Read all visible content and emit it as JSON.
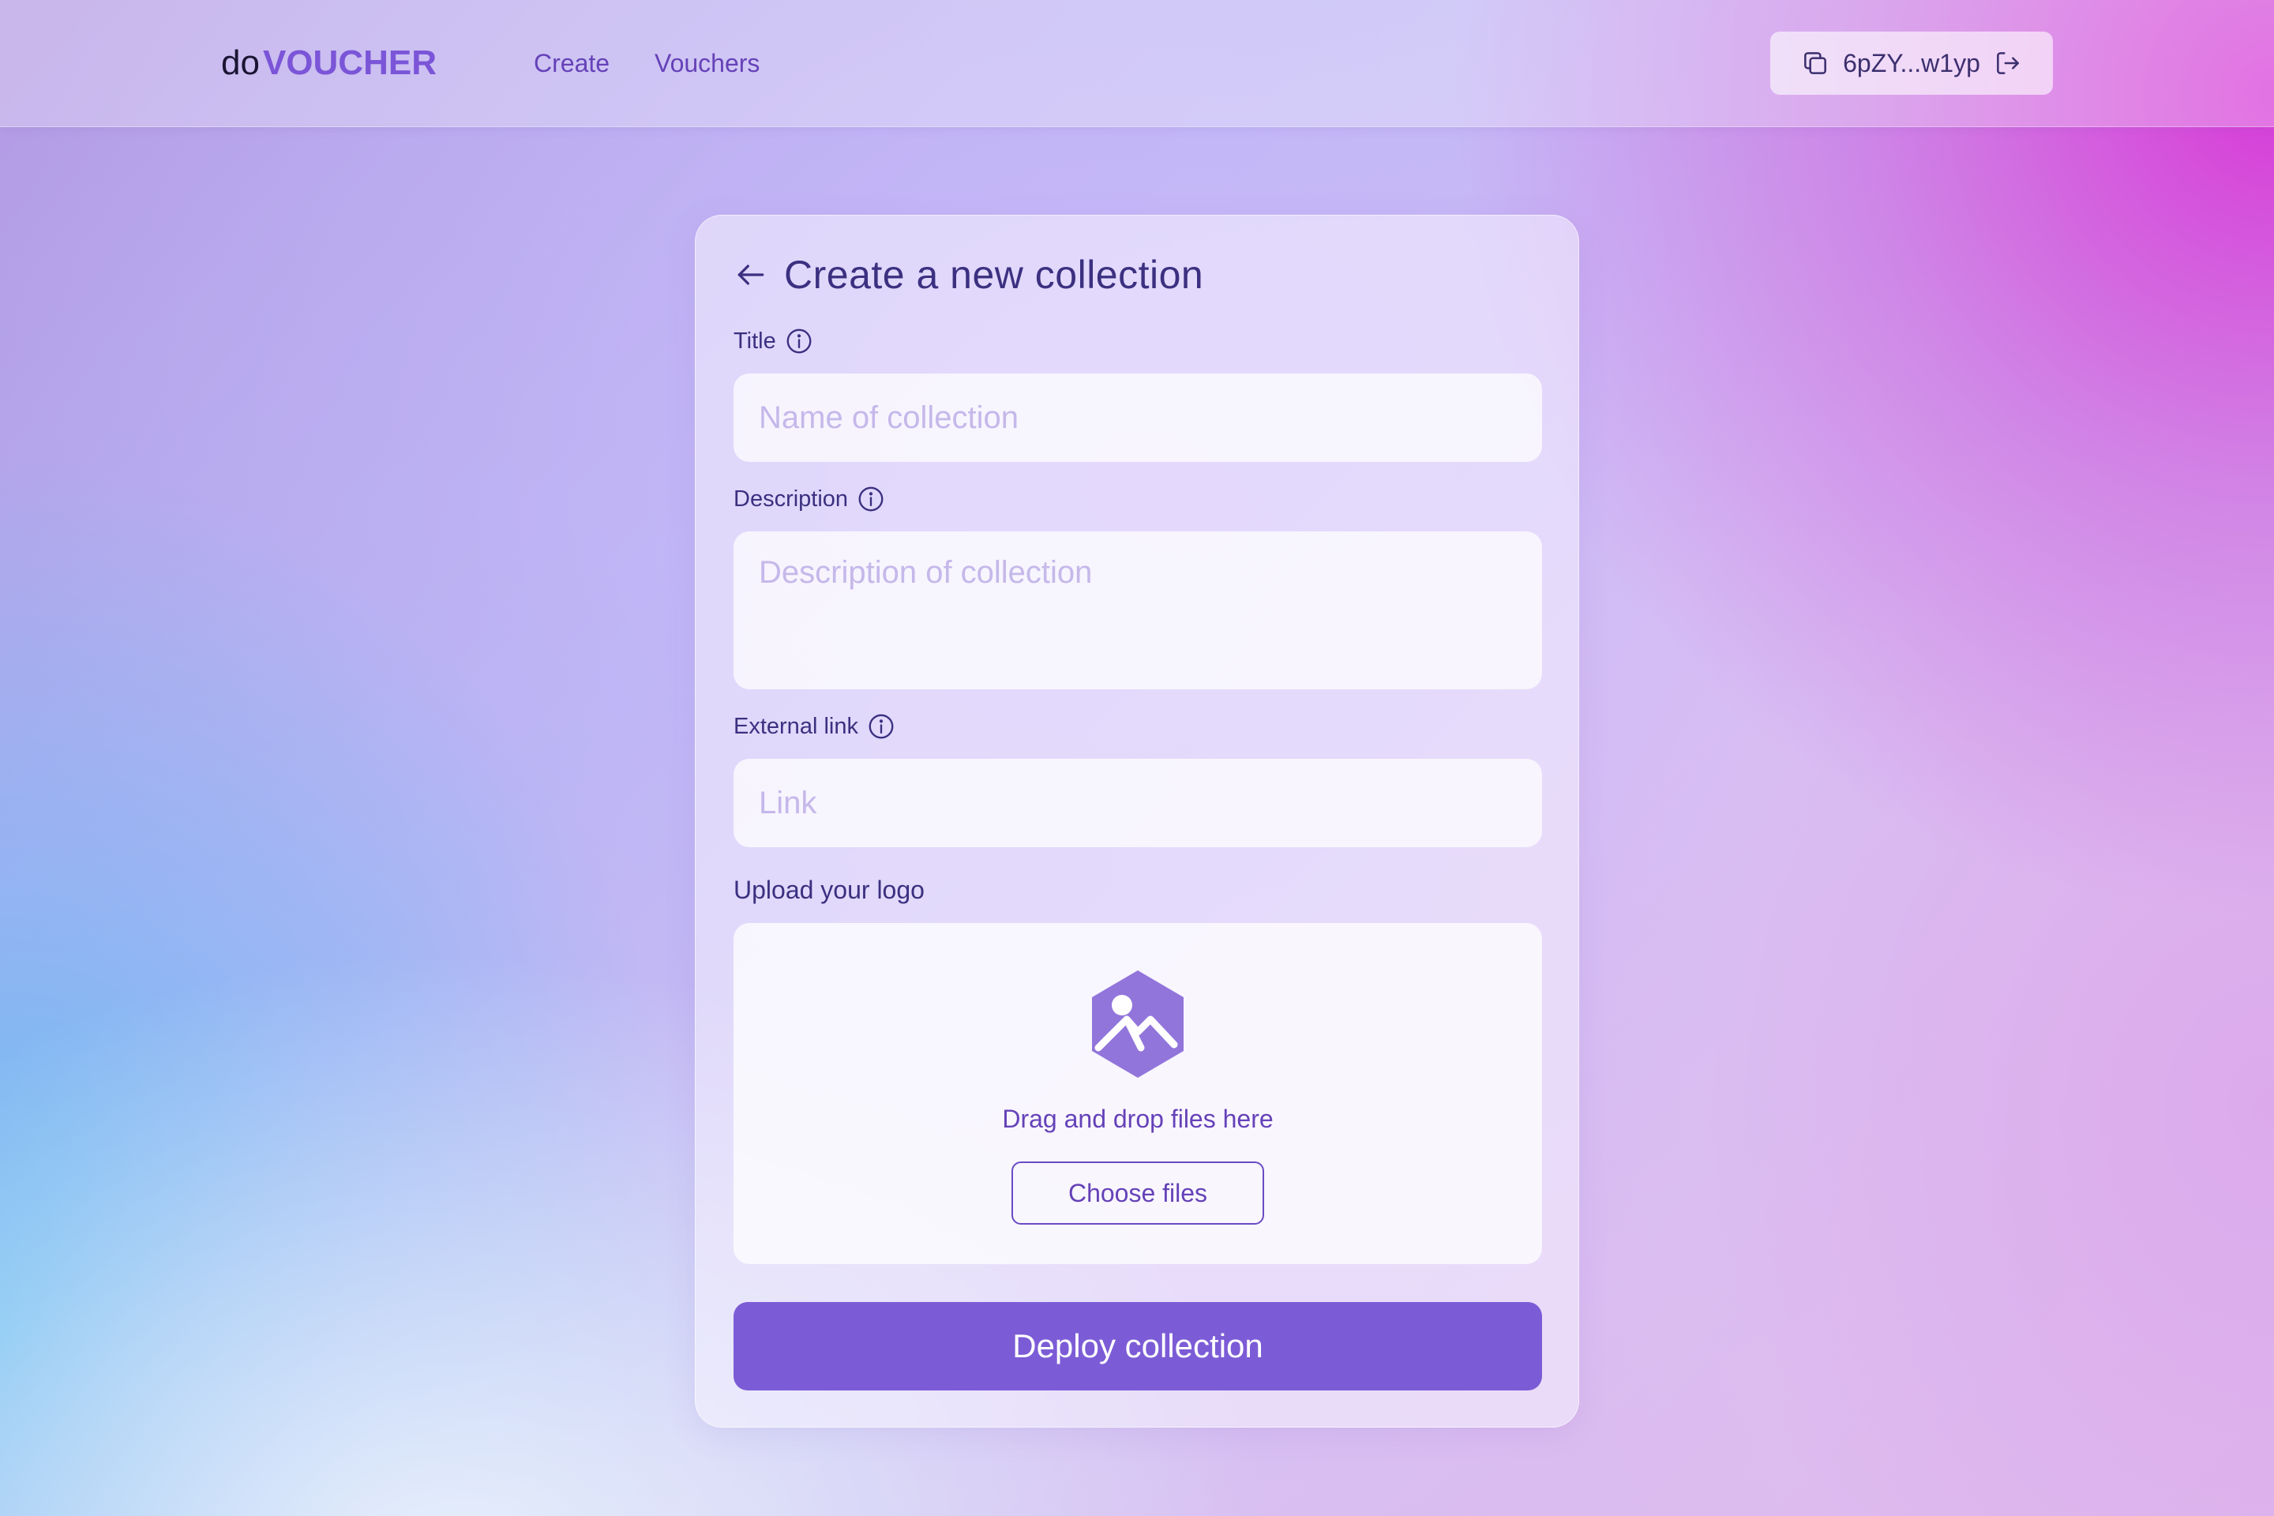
{
  "header": {
    "logo_prefix": "do",
    "logo_brand": "VOUCHER",
    "nav": [
      {
        "label": "Create"
      },
      {
        "label": "Vouchers"
      }
    ],
    "wallet": {
      "address": "6pZY...w1yp",
      "copy_icon": "copy-icon",
      "logout_icon": "logout-icon"
    }
  },
  "form": {
    "title": "Create a new collection",
    "back_icon": "arrow-left-icon",
    "title_field": {
      "label": "Title",
      "placeholder": "Name of collection",
      "value": ""
    },
    "description_field": {
      "label": "Description",
      "placeholder": "Description of collection",
      "value": ""
    },
    "link_field": {
      "label": "External link",
      "placeholder": "Link",
      "value": ""
    },
    "upload": {
      "label": "Upload your logo",
      "icon": "image-upload-icon",
      "drag_text": "Drag and drop files here",
      "choose_label": "Choose files"
    },
    "submit_label": "Deploy collection"
  },
  "colors": {
    "accent": "#7c5cd6",
    "brand": "#7b55d8",
    "text": "#3b3080",
    "placeholder": "#c5b8ea"
  }
}
